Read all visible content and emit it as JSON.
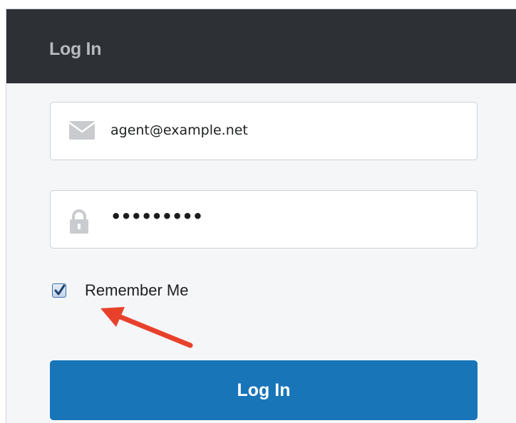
{
  "header": {
    "title": "Log In"
  },
  "form": {
    "email": {
      "value": "agent@example.net",
      "icon": "envelope-icon"
    },
    "password": {
      "masked_value": "•••••••••",
      "icon": "lock-icon"
    },
    "remember_me": {
      "label": "Remember Me",
      "checked": true
    },
    "submit_label": "Log In"
  },
  "annotation": {
    "arrow_color": "#e8412b",
    "arrow_target": "remember-me-checkbox"
  },
  "colors": {
    "header_bg": "#2d3035",
    "button_bg": "#1875b8",
    "page_bg": "#f5f6f8"
  }
}
